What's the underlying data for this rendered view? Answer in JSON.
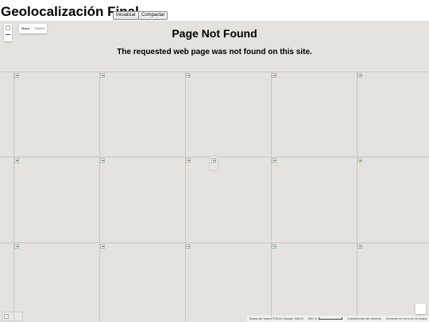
{
  "header": {
    "title": "Geolocalización Final",
    "init_label": "Inicializar",
    "compact_label": "Compactar"
  },
  "map": {
    "error_title": "Page Not Found",
    "error_message": "The requested web page was not found on this site.",
    "maptype": {
      "map_label": "Mapa",
      "satellite_label": "Satélite"
    },
    "attribution": {
      "data": "Datos del mapa ©2016 Google, INEGI",
      "scale": "200 m",
      "terms": "Condiciones del servicio",
      "report": "Informar un error en el mapa"
    },
    "icons": {
      "broken_tile": "broken-image-icon",
      "zoom": "zoom-control-icon",
      "pegman": "street-view-pegman-icon",
      "logo": "map-logo-icon"
    },
    "colors": {
      "map_background": "#e5e3df",
      "grid_line": "#c9c7c2"
    }
  }
}
